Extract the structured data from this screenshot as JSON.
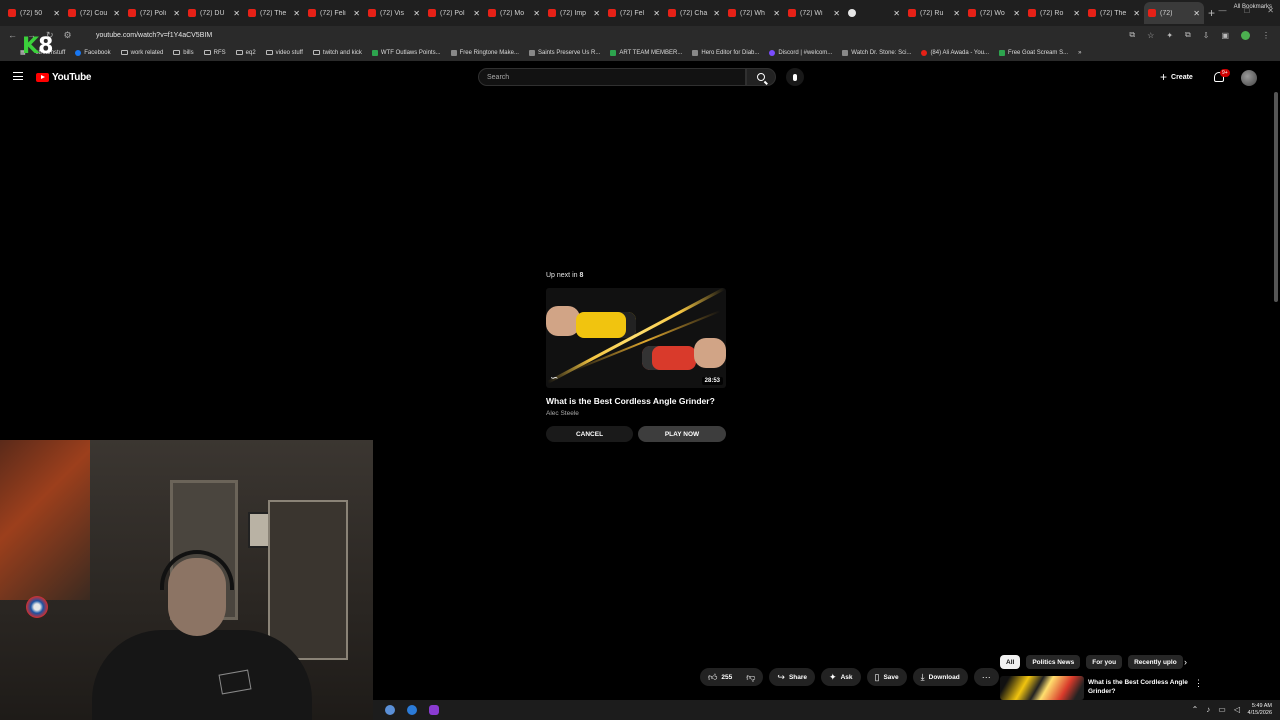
{
  "browser": {
    "tabs": [
      {
        "label": "(72) 50"
      },
      {
        "label": "(72) Cou"
      },
      {
        "label": "(72) Poli"
      },
      {
        "label": "(72) DU"
      },
      {
        "label": "(72) The"
      },
      {
        "label": "(72) Feli"
      },
      {
        "label": "(72) Vis"
      },
      {
        "label": "(72) Pol"
      },
      {
        "label": "(72) Mo"
      },
      {
        "label": "(72) Imp"
      },
      {
        "label": "(72) Fel"
      },
      {
        "label": "(72) Cha"
      },
      {
        "label": "(72) Wh"
      },
      {
        "label": "(72) Wi"
      },
      {
        "label": ""
      },
      {
        "label": "(72) Ru"
      },
      {
        "label": "(72) Wo"
      },
      {
        "label": "(72) Ro"
      },
      {
        "label": "(72) The"
      },
      {
        "label": "(72)"
      }
    ],
    "url": "youtube.com/watch?v=f1Y4aCV5BIM",
    "bookmarks": [
      {
        "label": "streamstuff",
        "icon": "none"
      },
      {
        "label": "Facebook",
        "icon": "fb"
      },
      {
        "label": "work related",
        "icon": "folder"
      },
      {
        "label": "bills",
        "icon": "folder"
      },
      {
        "label": "RFS",
        "icon": "folder"
      },
      {
        "label": "eq2",
        "icon": "folder"
      },
      {
        "label": "video stuff",
        "icon": "folder"
      },
      {
        "label": "twitch and kick",
        "icon": "folder"
      },
      {
        "label": "WTF Outlaws Points...",
        "icon": "green"
      },
      {
        "label": "Free Ringtone Make...",
        "icon": "page"
      },
      {
        "label": "Saints Preserve Us R...",
        "icon": "page"
      },
      {
        "label": "ART TEAM MEMBER...",
        "icon": "green"
      },
      {
        "label": "Hero Editor for Diab...",
        "icon": "page"
      },
      {
        "label": "Discord | #welcom...",
        "icon": "purple"
      },
      {
        "label": "Watch Dr. Stone: Sci...",
        "icon": "page"
      },
      {
        "label": "(84) Ali Awada - You...",
        "icon": "red"
      },
      {
        "label": "Free Goat Scream S...",
        "icon": "green"
      }
    ],
    "all_bookmarks_label": "All Bookmarks"
  },
  "overlay": {
    "logo_k": "K",
    "logo_8": "8"
  },
  "youtube": {
    "logo_text": "YouTube",
    "search_placeholder": "Search",
    "create_label": "Create",
    "notifications_badge": "9+"
  },
  "up_next": {
    "label_prefix": "Up next in",
    "countdown": "8",
    "video_title": "What is the Best Cordless Angle Grinder?",
    "channel": "Alec Steele",
    "duration": "28:53",
    "cancel_label": "CANCEL",
    "play_label": "PLAY NOW"
  },
  "actions": {
    "like_count": "255",
    "share_label": "Share",
    "ask_label": "Ask",
    "save_label": "Save",
    "download_label": "Download"
  },
  "chips": [
    {
      "label": "All",
      "active": true
    },
    {
      "label": "Politics News",
      "active": false
    },
    {
      "label": "For you",
      "active": false
    },
    {
      "label": "Recently uplo",
      "active": false
    }
  ],
  "related": {
    "title": "What is the Best Cordless Angle Grinder?"
  },
  "taskbar": {
    "time": "5:49 AM",
    "date": "4/15/2026"
  }
}
